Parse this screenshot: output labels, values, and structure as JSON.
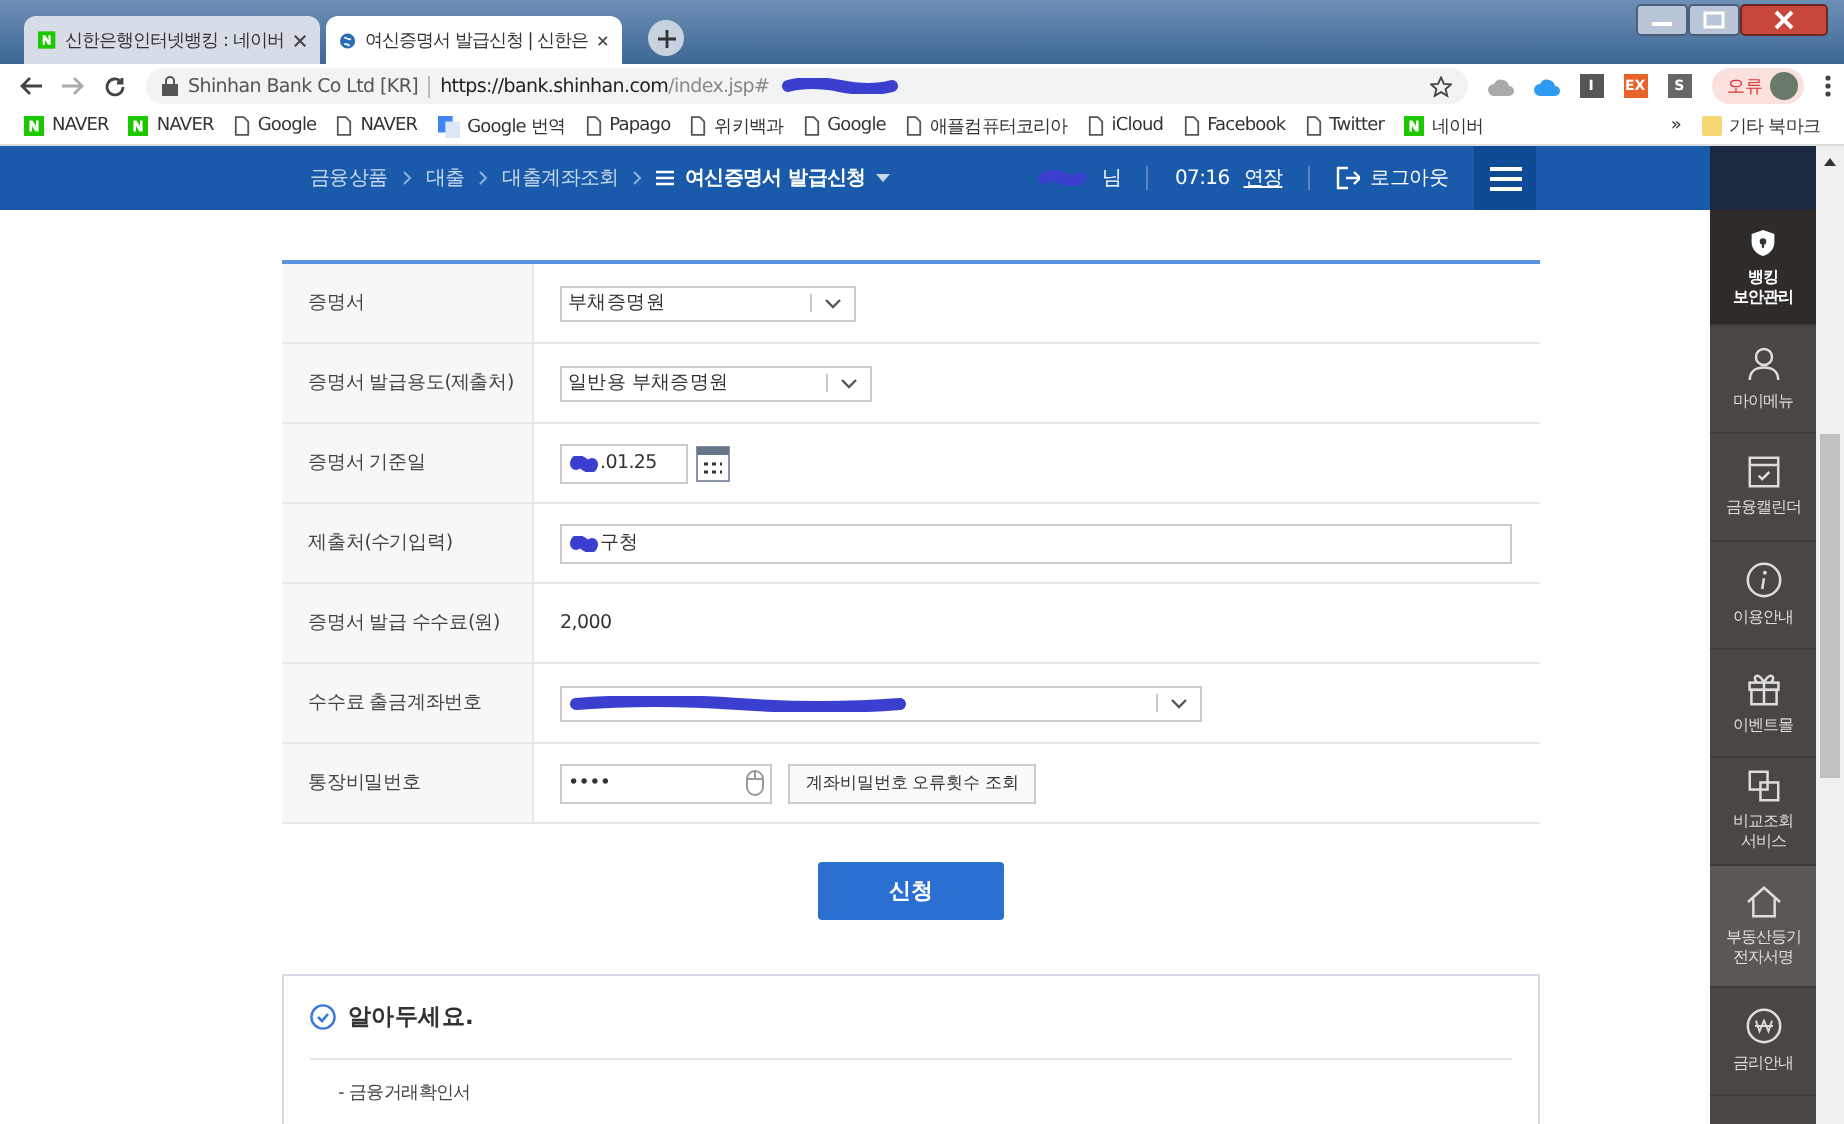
{
  "browser": {
    "tabs": [
      {
        "title": "신한은행인터넷뱅킹 : 네이버",
        "selected": false
      },
      {
        "title": "여신증명서 발급신청 | 신한은",
        "selected": true
      }
    ],
    "site": "Shinhan Bank Co Ltd [KR]",
    "url_host": "https://bank.shinhan.com",
    "url_path": "/index.jsp#",
    "extensions": [
      {
        "kind": "cloud"
      },
      {
        "kind": "icloud"
      },
      {
        "kind": "letter",
        "label": "I",
        "color": "#555555"
      },
      {
        "kind": "letter",
        "label": "EX",
        "color": "#e8622a"
      },
      {
        "kind": "letter",
        "label": "S",
        "color": "#666666"
      }
    ],
    "profile_label": "오류",
    "bookmarks": [
      {
        "label": "NAVER",
        "kind": "naver"
      },
      {
        "label": "NAVER",
        "kind": "naver"
      },
      {
        "label": "Google",
        "kind": "page"
      },
      {
        "label": "NAVER",
        "kind": "page"
      },
      {
        "label": "Google 번역",
        "kind": "translate"
      },
      {
        "label": "Papago",
        "kind": "page"
      },
      {
        "label": "위키백과",
        "kind": "page"
      },
      {
        "label": "Google",
        "kind": "page"
      },
      {
        "label": "애플컴퓨터코리아",
        "kind": "page"
      },
      {
        "label": "iCloud",
        "kind": "page"
      },
      {
        "label": "Facebook",
        "kind": "page"
      },
      {
        "label": "Twitter",
        "kind": "page"
      },
      {
        "label": "네이버",
        "kind": "naver"
      }
    ],
    "more": "»",
    "other_bookmarks": "기타 북마크"
  },
  "nav": {
    "breadcrumbs": [
      "금융상품",
      "대출",
      "대출계좌조회"
    ],
    "current": "여신증명서 발급신청",
    "user_suffix": "님",
    "time": "07:16",
    "extend": "연장",
    "logout": "로그아웃"
  },
  "form": {
    "rows": [
      {
        "label": "증명서",
        "kind": "select",
        "value": "부채증명원"
      },
      {
        "label": "증명서 발급용도(제출처)",
        "kind": "select",
        "value": "일반용 부채증명원"
      },
      {
        "label": "증명서 기준일",
        "kind": "date",
        "value": ".01.25",
        "redacted": true
      },
      {
        "label": "제출처(수기입력)",
        "kind": "text",
        "value": "구청",
        "redacted": true
      },
      {
        "label": "증명서 발급 수수료(원)",
        "kind": "static",
        "value": "2,000"
      },
      {
        "label": "수수료 출금계좌번호",
        "kind": "account",
        "redacted": true
      },
      {
        "label": "통장비밀번호",
        "kind": "password",
        "value": "••••",
        "button": "계좌비밀번호 오류횟수 조회"
      }
    ]
  },
  "submit": "신청",
  "notice": {
    "title": "알아두세요.",
    "items": [
      "- 금융거래확인서"
    ]
  },
  "side_menu": [
    {
      "kind": "shield",
      "lines": [
        "뱅킹",
        "보안관리"
      ]
    },
    {
      "kind": "person",
      "lines": [
        "마이메뉴"
      ]
    },
    {
      "kind": "calendar",
      "lines": [
        "금융캘린더"
      ]
    },
    {
      "kind": "info",
      "lines": [
        "이용안내"
      ]
    },
    {
      "kind": "gift",
      "lines": [
        "이벤트몰"
      ]
    },
    {
      "kind": "compare",
      "lines": [
        "비교조회",
        "서비스"
      ]
    },
    {
      "kind": "house",
      "lines": [
        "부동산등기",
        "전자서명"
      ]
    },
    {
      "kind": "won",
      "lines": [
        "금리안내"
      ]
    }
  ]
}
